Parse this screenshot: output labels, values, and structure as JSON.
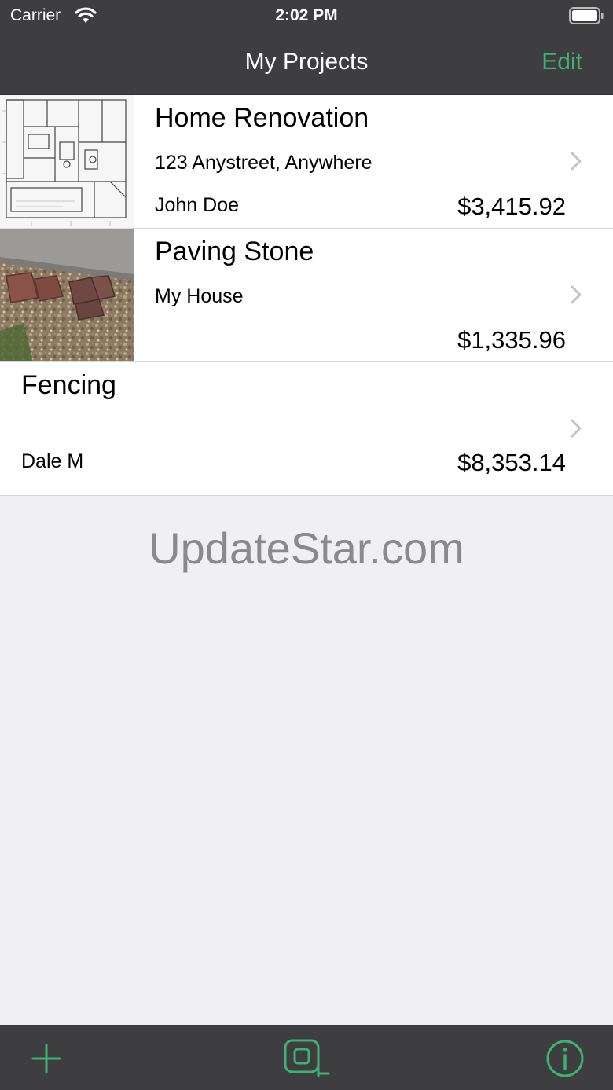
{
  "status_bar": {
    "carrier": "Carrier",
    "time": "2:02 PM",
    "wifi_icon": "wifi-icon",
    "battery_icon": "battery-icon"
  },
  "nav_bar": {
    "title": "My Projects",
    "edit_label": "Edit"
  },
  "projects": [
    {
      "title": "Home Renovation",
      "address": "123 Anystreet, Anywhere",
      "client": "John Doe",
      "total": "$3,415.92",
      "thumbnail": "floor-plan-thumbnail"
    },
    {
      "title": "Paving Stone",
      "address": "My House",
      "client": "",
      "total": "$1,335.96",
      "thumbnail": "paving-stone-photo-thumbnail"
    },
    {
      "title": "Fencing",
      "address": "",
      "client": "Dale M",
      "total": "$8,353.14",
      "thumbnail": ""
    }
  ],
  "watermark": "UpdateStar.com",
  "toolbar": {
    "add_icon": "plus-icon",
    "measure_icon": "square-measure-icon",
    "info_icon": "info-icon"
  },
  "colors": {
    "bar_background": "#3e3e40",
    "accent": "#3cb371",
    "list_background": "#efeff4"
  }
}
